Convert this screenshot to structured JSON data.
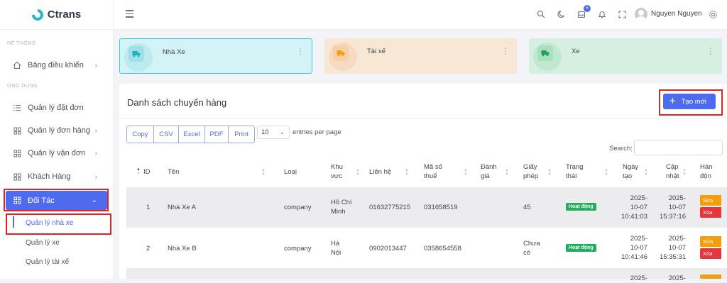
{
  "app": {
    "name": "Ctrans"
  },
  "sidebar": {
    "sections": [
      {
        "label": "HỆ THỐNG"
      },
      {
        "label": "ỨNG DỤNG"
      }
    ],
    "items": [
      {
        "label": "Bảng điều khiển",
        "icon": "home-icon"
      },
      {
        "label": "Quản lý đặt đơn",
        "icon": "list-icon"
      },
      {
        "label": "Quản lý đơn hàng",
        "icon": "grid-icon"
      },
      {
        "label": "Quản lý vận đơn",
        "icon": "grid-icon"
      },
      {
        "label": "Khách Hàng",
        "icon": "grid-icon"
      },
      {
        "label": "Đối Tác",
        "icon": "grid-icon",
        "active": true
      }
    ],
    "subitems": [
      {
        "label": "Quản lý nhà xe",
        "active": true
      },
      {
        "label": "Quản lý xe"
      },
      {
        "label": "Quản lý tài xế"
      }
    ]
  },
  "topbar": {
    "user_name": "Nguyen Nguyen",
    "notification_count": "5"
  },
  "cards": [
    {
      "title": "Nhà Xe",
      "color": "#d3f3f6",
      "border": "#3ec9d6",
      "accent": "#1fb0c2"
    },
    {
      "title": "Tài xế",
      "color": "#f8e7d4",
      "accent": "#f59e0b"
    },
    {
      "title": "Xe",
      "color": "#d5f0e0",
      "accent": "#22a05a"
    }
  ],
  "panel": {
    "title": "Danh sách chuyến hàng",
    "create_label": "Tạo mới",
    "export_buttons": [
      "Copy",
      "CSV",
      "Excel",
      "PDF",
      "Print"
    ],
    "page_size": "10",
    "entries_label": "entries per page",
    "search_label": "Search:"
  },
  "table": {
    "headers": [
      [
        "ID"
      ],
      [
        "Tên"
      ],
      [
        "Loại"
      ],
      [
        "Khu",
        "vực"
      ],
      [
        "Liên hệ"
      ],
      [
        "Mã số",
        "thuế"
      ],
      [
        "Đánh",
        "giá"
      ],
      [
        "Giấy",
        "phép"
      ],
      [
        "Trạng",
        "thái"
      ],
      [
        "Ngày",
        "tạo"
      ],
      [
        "Cập",
        "nhật"
      ],
      [
        "Hàn",
        "độn"
      ]
    ],
    "rows": [
      {
        "id": "1",
        "name": "Nhà Xe A",
        "type": "company",
        "area": [
          "Hồ Chí",
          "Minh"
        ],
        "contact": "01632775215",
        "tax": "031658519",
        "rating": "",
        "license": [
          "45"
        ],
        "status": "Hoạt động",
        "created": [
          "2025-",
          "10-07",
          "10:41:03"
        ],
        "updated": [
          "2025-",
          "10-07",
          "15:37:16"
        ],
        "edit": "Sửa",
        "delete": "Xóa"
      },
      {
        "id": "2",
        "name": "Nhà Xe B",
        "type": "company",
        "area": [
          "Hà",
          "Nội"
        ],
        "contact": "0902013447",
        "tax": "0358654558",
        "rating": "",
        "license": [
          "Chưa",
          "có"
        ],
        "status": "Hoạt động",
        "created": [
          "2025-",
          "10-07",
          "10:41:46"
        ],
        "updated": [
          "2025-",
          "10-07",
          "15:35:31"
        ],
        "edit": "Sửa",
        "delete": "Xóa"
      },
      {
        "created": [
          "2025-"
        ],
        "updated": [
          "2025-"
        ]
      }
    ]
  }
}
